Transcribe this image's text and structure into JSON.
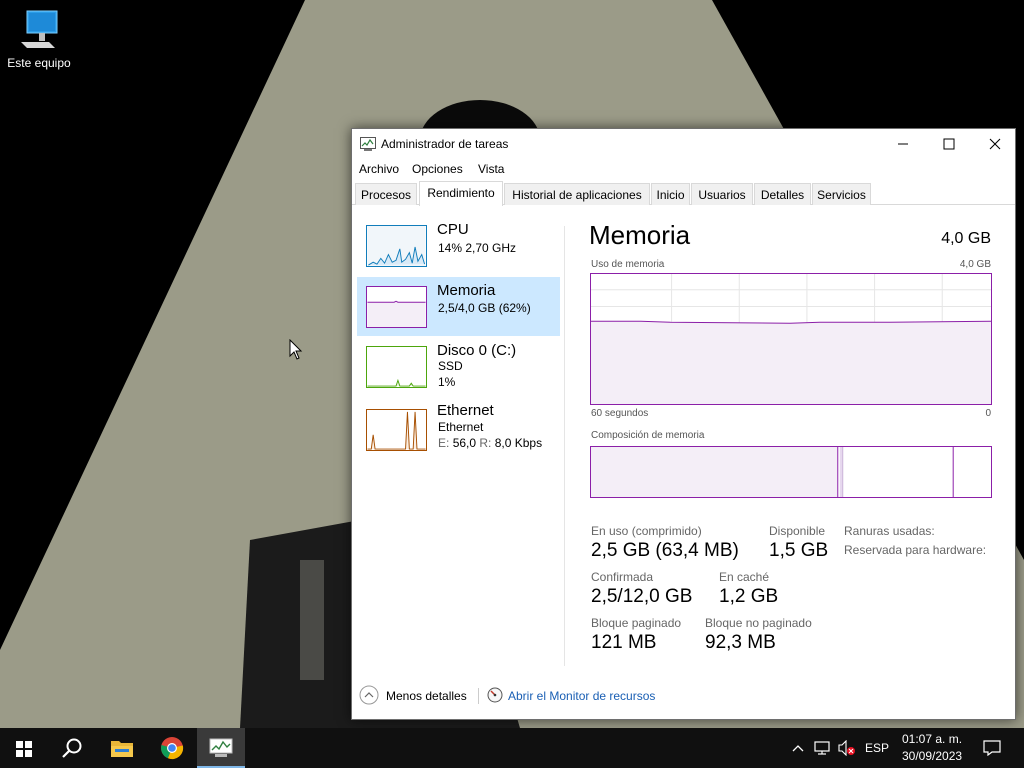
{
  "desktop": {
    "icon_label": "Este equipo"
  },
  "window": {
    "title": "Administrador de tareas",
    "menu": [
      "Archivo",
      "Opciones",
      "Vista"
    ],
    "tabs": [
      "Procesos",
      "Rendimiento",
      "Historial de aplicaciones",
      "Inicio",
      "Usuarios",
      "Detalles",
      "Servicios"
    ],
    "active_tab": "Rendimiento"
  },
  "sidebar": {
    "items": [
      {
        "name": "CPU",
        "line1": "14%  2,70 GHz",
        "line2": "",
        "color": "#117dbb"
      },
      {
        "name": "Memoria",
        "line1": "2,5/4,0 GB (62%)",
        "line2": "",
        "color": "#8b1fa8"
      },
      {
        "name": "Disco 0 (C:)",
        "line1": "SSD",
        "line2": "1%",
        "color": "#4da60c"
      },
      {
        "name": "Ethernet",
        "line1": "Ethernet",
        "line2_prefix_e": "E:",
        "line2_e": "56,0",
        "line2_prefix_r": "R:",
        "line2_r": "8,0 Kbps",
        "color": "#a74f01"
      }
    ]
  },
  "memory": {
    "title": "Memoria",
    "total": "4,0 GB",
    "usage_label": "Uso de memoria",
    "usage_max": "4,0 GB",
    "time_left": "60 segundos",
    "time_right": "0",
    "composition_label": "Composición de memoria",
    "usage_level": 0.62,
    "stats": {
      "in_use_label": "En uso (comprimido)",
      "in_use_value": "2,5 GB (63,4 MB)",
      "available_label": "Disponible",
      "available_value": "1,5 GB",
      "slots_label": "Ranuras usadas:",
      "reserved_label": "Reservada para hardware:",
      "committed_label": "Confirmada",
      "committed_value": "2,5/12,0 GB",
      "cached_label": "En caché",
      "cached_value": "1,2 GB",
      "paged_label": "Bloque paginado",
      "paged_value": "121 MB",
      "nonpaged_label": "Bloque no paginado",
      "nonpaged_value": "92,3 MB"
    },
    "accent": "#8b1fa8"
  },
  "footer": {
    "fewer_details": "Menos detalles",
    "resource_monitor": "Abrir el Monitor de recursos"
  },
  "taskbar": {
    "language": "ESP",
    "time": "01:07 a. m.",
    "date": "30/09/2023",
    "apps": [
      "start-icon",
      "search-icon",
      "file-explorer-icon",
      "chrome-icon",
      "task-manager-icon"
    ]
  }
}
